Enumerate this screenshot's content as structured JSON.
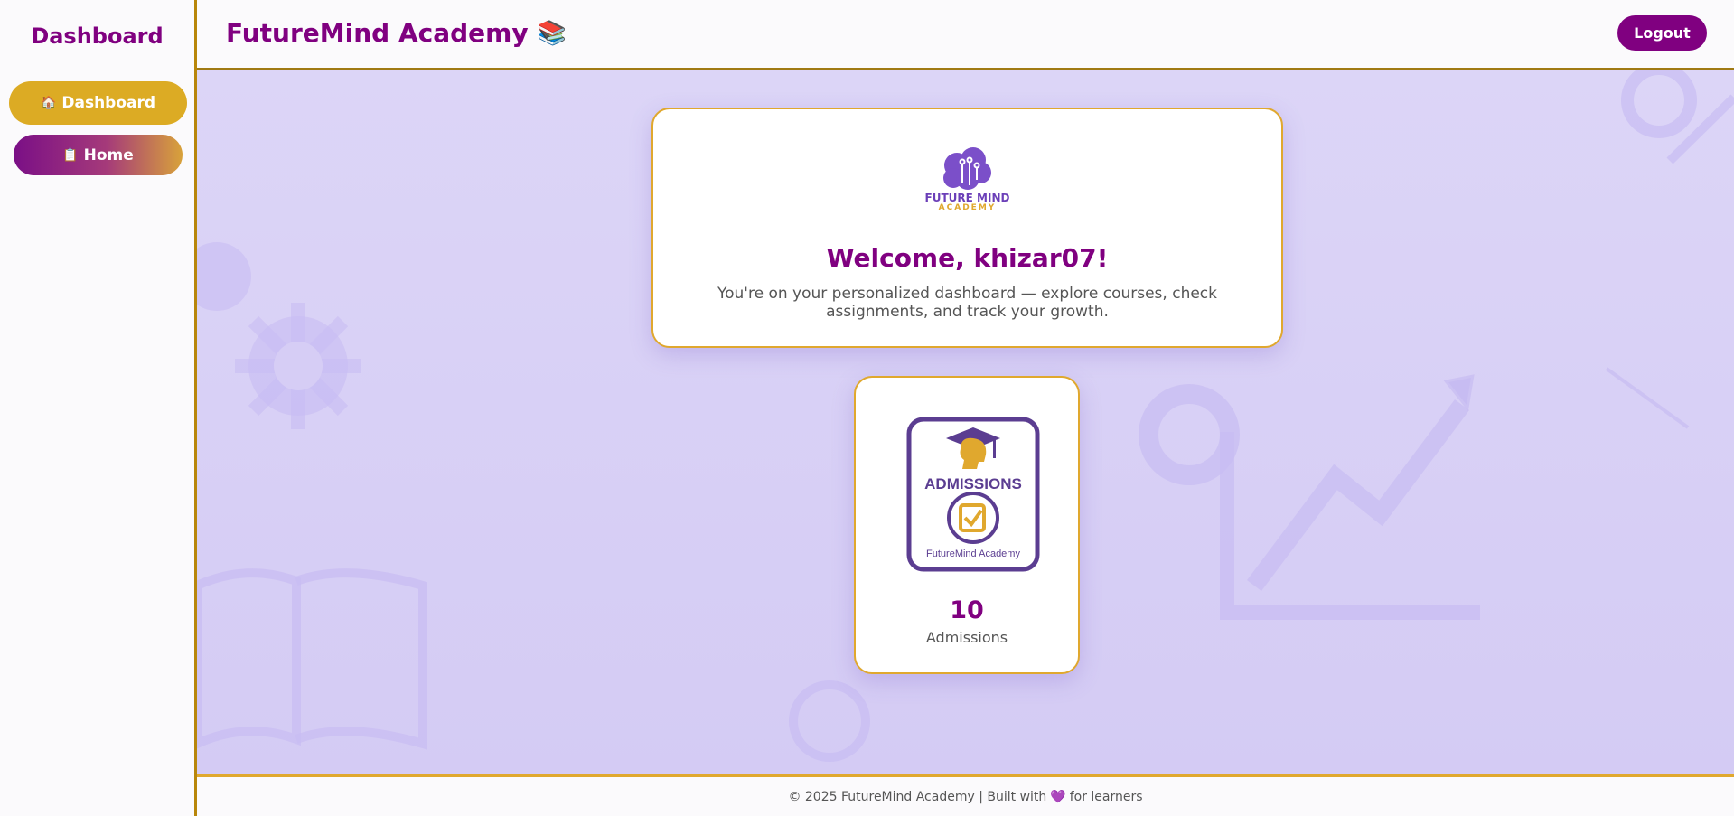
{
  "sidebar": {
    "title": "Dashboard",
    "items": [
      {
        "icon": "🏠",
        "label": "Dashboard"
      },
      {
        "icon": "📋",
        "label": "Home"
      }
    ]
  },
  "header": {
    "title": "FutureMind Academy",
    "title_icon": "📚",
    "logout_label": "Logout"
  },
  "welcome": {
    "logo_line1": "FUTURE MIND",
    "logo_line2": "ACADEMY",
    "title": "Welcome, khizar07!",
    "subtitle": "You're on your personalized dashboard — explore courses, check assignments, and track your growth."
  },
  "stat": {
    "img_heading": "ADMISSIONS",
    "img_caption": "FutureMind Academy",
    "value": "10",
    "label": "Admissions"
  },
  "footer": {
    "prefix": "© 2025 FutureMind Academy | Built with",
    "heart": "💜",
    "suffix": "for learners"
  },
  "colors": {
    "brand": "#800080",
    "accent": "#e0a82e",
    "background": "#d8d0f6"
  }
}
